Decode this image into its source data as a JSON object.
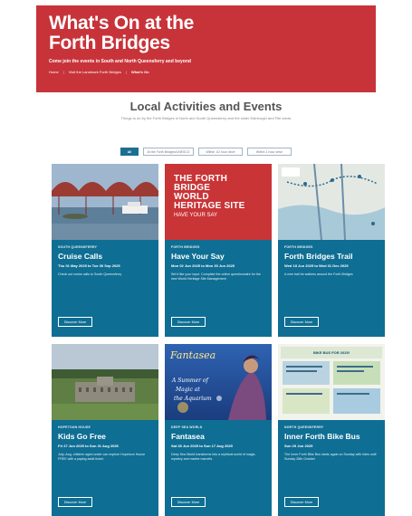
{
  "hero": {
    "title_line1": "What's On at the",
    "title_line2": "Forth Bridges",
    "subtitle": "Come join the events in South and North Queensferry and beyond",
    "breadcrumbs": [
      "Home",
      "Visit the Landmark Forth Bridges",
      "What's On"
    ]
  },
  "section": {
    "title": "Local Activities and Events",
    "subtitle": "Things to do by the Forth Bridges in North and South Queensferry and the wider Edinburgh and Fife areas"
  },
  "filters": [
    {
      "label": "All",
      "active": true
    },
    {
      "label": "At the Forth Bridges/UNESCO",
      "active": false
    },
    {
      "label": "Within 1/2 hour drive",
      "active": false
    },
    {
      "label": "Within 1 hour drive",
      "active": false
    }
  ],
  "cards": [
    {
      "category": "South Queensferry",
      "title": "Cruise Calls",
      "date": "Thu 01 May 2025 to Tue 30 Sep 2025",
      "desc": "Check out cruise calls to South Queensferry",
      "button": "Discover More",
      "image": "bridge-photo"
    },
    {
      "category": "Forth Bridges",
      "title": "Have Your Say",
      "date": "Mon 02 Jun 2025 to Mon 30 Jun 2025",
      "desc": "We'd like your input. Complete the online questionnaire for the new World Heritage Site Management",
      "button": "Discover More",
      "image": "heritage-graphic",
      "image_text_1": "THE FORTH",
      "image_text_2": "BRIDGE",
      "image_text_3": "WORLD",
      "image_text_4": "HERITAGE SITE",
      "image_text_5": "HAVE YOUR SAY"
    },
    {
      "category": "Forth Bridges",
      "title": "Forth Bridges Trail",
      "date": "Wed 18 Jun 2025 to Wed 31 Dec 2025",
      "desc": "A new trail for walkers around the Forth Bridges",
      "button": "Discover More",
      "image": "trail-map"
    },
    {
      "category": "Hopetoun House",
      "title": "Kids Go Free",
      "date": "Fri 27 Jun 2025 to Sun 31 Aug 2025",
      "desc": "July–Aug, children aged under can explore Hopetoun House FREE with a paying adult ticket.",
      "button": "Discover More",
      "image": "house-photo"
    },
    {
      "category": "Deep Sea World",
      "title": "Fantasea",
      "date": "Sat 28 Jun 2025 to Sun 17 Aug 2025",
      "desc": "Deep Sea World transforms into a mythical world of magic, mystery and marine marvels.",
      "button": "Discover More",
      "image": "fantasea-poster",
      "image_text_1": "Fantasea",
      "image_text_2": "A Summer of",
      "image_text_3": "Magic at",
      "image_text_4": "the Aquarium"
    },
    {
      "category": "North Queensferry",
      "title": "Inner Forth Bike Bus",
      "date": "Sun 29 Jun 2025",
      "desc": "The Inner Forth Bike Bus starts again on Sunday with rides until Sunday 28th October",
      "button": "Discover More",
      "image": "bike-bus-flyer",
      "image_text_1": "BIKE BUS FOR 2025!"
    }
  ],
  "colors": {
    "hero_red": "#c8333a",
    "card_blue": "#0f6e93",
    "filter_active": "#1d6f8f"
  }
}
